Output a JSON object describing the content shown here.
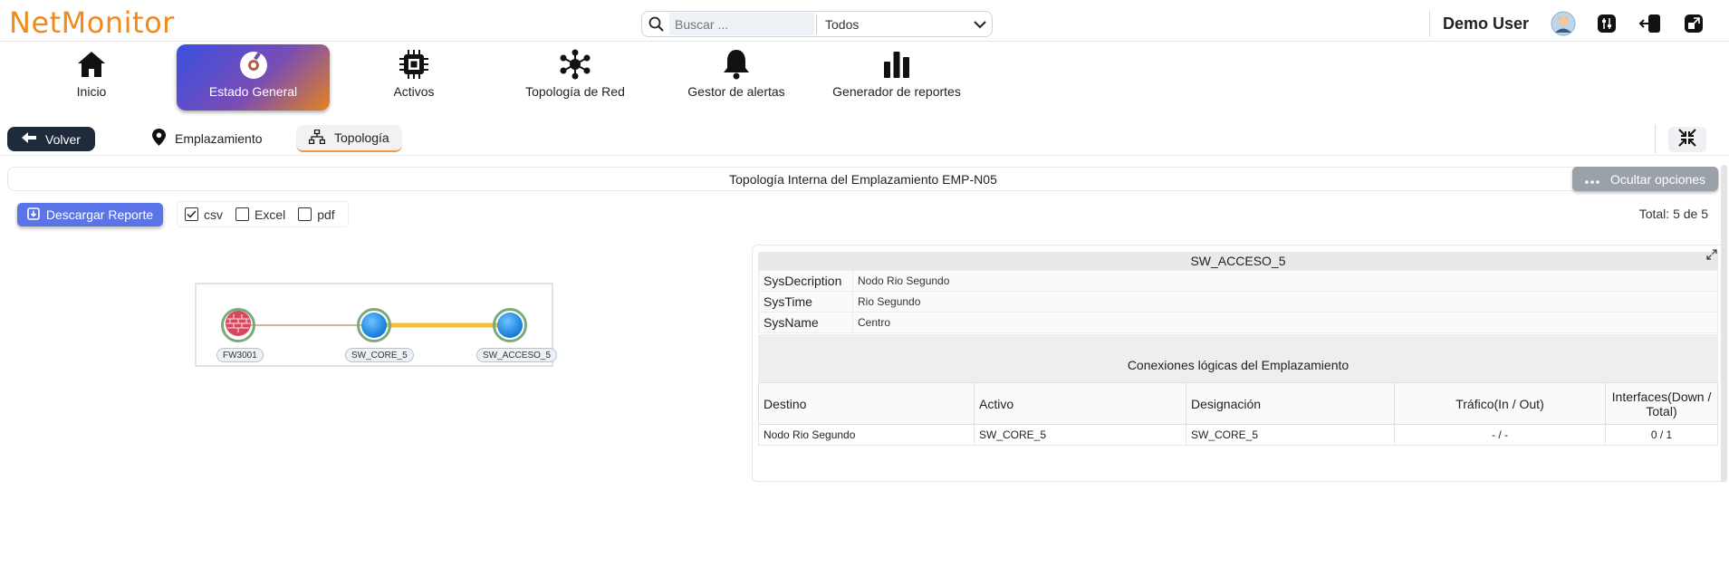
{
  "app": {
    "logo": "NetMonitor"
  },
  "search": {
    "placeholder": "Buscar ...",
    "scope": "Todos"
  },
  "user": {
    "name": "Demo User"
  },
  "nav": [
    {
      "label": "Inicio",
      "icon": "home-icon"
    },
    {
      "label": "Estado General",
      "icon": "gauge-icon",
      "active": true
    },
    {
      "label": "Activos",
      "icon": "chip-icon"
    },
    {
      "label": "Topología de Red",
      "icon": "network-icon"
    },
    {
      "label": "Gestor de alertas",
      "icon": "bell-icon"
    },
    {
      "label": "Generador de reportes",
      "icon": "bar-chart-icon"
    }
  ],
  "subbar": {
    "back_label": "Volver",
    "tabs": [
      {
        "label": "Emplazamiento",
        "icon": "location-pin-icon"
      },
      {
        "label": "Topología",
        "icon": "hierarchy-icon",
        "active": true
      }
    ]
  },
  "section": {
    "title": "Topología Interna del Emplazamiento EMP-N05",
    "hide_options_label": "Ocultar opciones"
  },
  "report": {
    "download_label": "Descargar Reporte",
    "formats": [
      {
        "label": "csv",
        "checked": true
      },
      {
        "label": "Excel",
        "checked": false
      },
      {
        "label": "pdf",
        "checked": false
      }
    ],
    "total": "Total: 5 de 5"
  },
  "topology": {
    "nodes": [
      {
        "label": "FW3001",
        "type": "firewall"
      },
      {
        "label": "SW_CORE_5",
        "type": "switch"
      },
      {
        "label": "SW_ACCESO_5",
        "type": "switch"
      }
    ],
    "links": [
      {
        "from": "FW3001",
        "to": "SW_CORE_5",
        "color": "#c9b99a"
      },
      {
        "from": "SW_CORE_5",
        "to": "SW_ACCESO_5",
        "color": "#f2c232"
      }
    ]
  },
  "device": {
    "name": "SW_ACCESO_5",
    "info": [
      {
        "key": "SysDecription",
        "value": "Nodo Rio Segundo"
      },
      {
        "key": "SysTime",
        "value": "Rio Segundo"
      },
      {
        "key": "SysName",
        "value": "Centro"
      }
    ],
    "connections_title": "Conexiones lógicas del Emplazamiento",
    "columns": [
      "Destino",
      "Activo",
      "Designación",
      "Tráfico(In / Out)",
      "Interfaces(Down / Total)"
    ],
    "rows": [
      [
        "Nodo Rio Segundo",
        "SW_CORE_5",
        "SW_CORE_5",
        "- / -",
        "0 / 1"
      ]
    ]
  },
  "colors": {
    "brand": "#f08a1e",
    "accent": "#5b74e8",
    "dark": "#1f2a3a"
  }
}
